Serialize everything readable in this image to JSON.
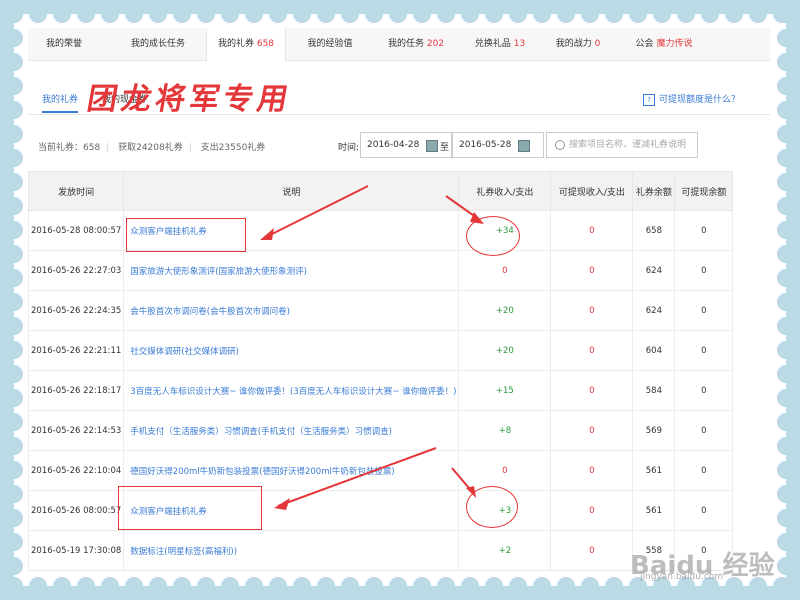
{
  "nav": {
    "tabs": [
      {
        "label": "我的荣誉",
        "count": ""
      },
      {
        "label": "我的成长任务",
        "count": ""
      },
      {
        "label": "我的礼券",
        "count": "658"
      },
      {
        "label": "我的经验值",
        "count": ""
      },
      {
        "label": "我的任务",
        "count": "202"
      },
      {
        "label": "兑换礼品",
        "count": "13"
      },
      {
        "label": "我的战力",
        "count": "0"
      },
      {
        "label": "公会",
        "count": "魔力传说"
      }
    ]
  },
  "overlay_title": "团龙将军专用",
  "sub_tabs": [
    "我的礼券",
    "我的现金券"
  ],
  "help_text": "可提现额度是什么？",
  "stats": {
    "current": "当前礼券：658",
    "earned": "获取24208礼券",
    "spent": "支出23550礼券"
  },
  "filter": {
    "time_label": "时间:",
    "date_from": "2016-04-28",
    "to_label": "至",
    "date_to": "2016-05-28",
    "search_placeholder": "搜索项目名称，谨减礼券说明"
  },
  "table": {
    "headers": [
      "发放时间",
      "说明",
      "礼券收入/支出",
      "可提现收入/支出",
      "礼券余额",
      "可提现余额"
    ],
    "rows": [
      {
        "time": "2016-05-28 08:00:57",
        "desc": "众测客户端挂机礼券",
        "income": "+34",
        "cash": "0",
        "balance": "658",
        "cash_balance": "0"
      },
      {
        "time": "2016-05-26 22:27:03",
        "desc": "国家旅游大使形象测评(国家旅游大使形象测评)",
        "income": "0",
        "cash": "0",
        "balance": "624",
        "cash_balance": "0"
      },
      {
        "time": "2016-05-26 22:24:35",
        "desc": "会牛股首次市调问卷(会牛股首次市调问卷)",
        "income": "+20",
        "cash": "0",
        "balance": "624",
        "cash_balance": "0"
      },
      {
        "time": "2016-05-26 22:21:11",
        "desc": "社交媒体调研(社交媒体调研)",
        "income": "+20",
        "cash": "0",
        "balance": "604",
        "cash_balance": "0"
      },
      {
        "time": "2016-05-26 22:18:17",
        "desc": "3百度无人车标识设计大赛~ 谁你做评委！(3百度无人车标识设计大赛~ 谁你做评委！)",
        "income": "+15",
        "cash": "0",
        "balance": "584",
        "cash_balance": "0"
      },
      {
        "time": "2016-05-26 22:14:53",
        "desc": "手机支付（生活服务类）习惯调查(手机支付（生活服务类）习惯调查)",
        "income": "+8",
        "cash": "0",
        "balance": "569",
        "cash_balance": "0"
      },
      {
        "time": "2016-05-26 22:10:04",
        "desc": "德国好沃得200ml牛奶新包装投票(德国好沃得200ml牛奶新包装投票)",
        "income": "0",
        "cash": "0",
        "balance": "561",
        "cash_balance": "0"
      },
      {
        "time": "2016-05-26 08:00:57",
        "desc": "众测客户端挂机礼券",
        "income": "+3",
        "cash": "0",
        "balance": "561",
        "cash_balance": "0"
      },
      {
        "time": "2016-05-19 17:30:08",
        "desc": "数据标注(明星标签(高福利))",
        "income": "+2",
        "cash": "0",
        "balance": "558",
        "cash_balance": "0"
      }
    ]
  },
  "watermark": "Baidu 经验",
  "watermark_url": "jingyan.baidu.com",
  "colors": {
    "accent_blue": "#3a7bd5",
    "red": "#e3373a",
    "green": "#2a9a3a"
  }
}
